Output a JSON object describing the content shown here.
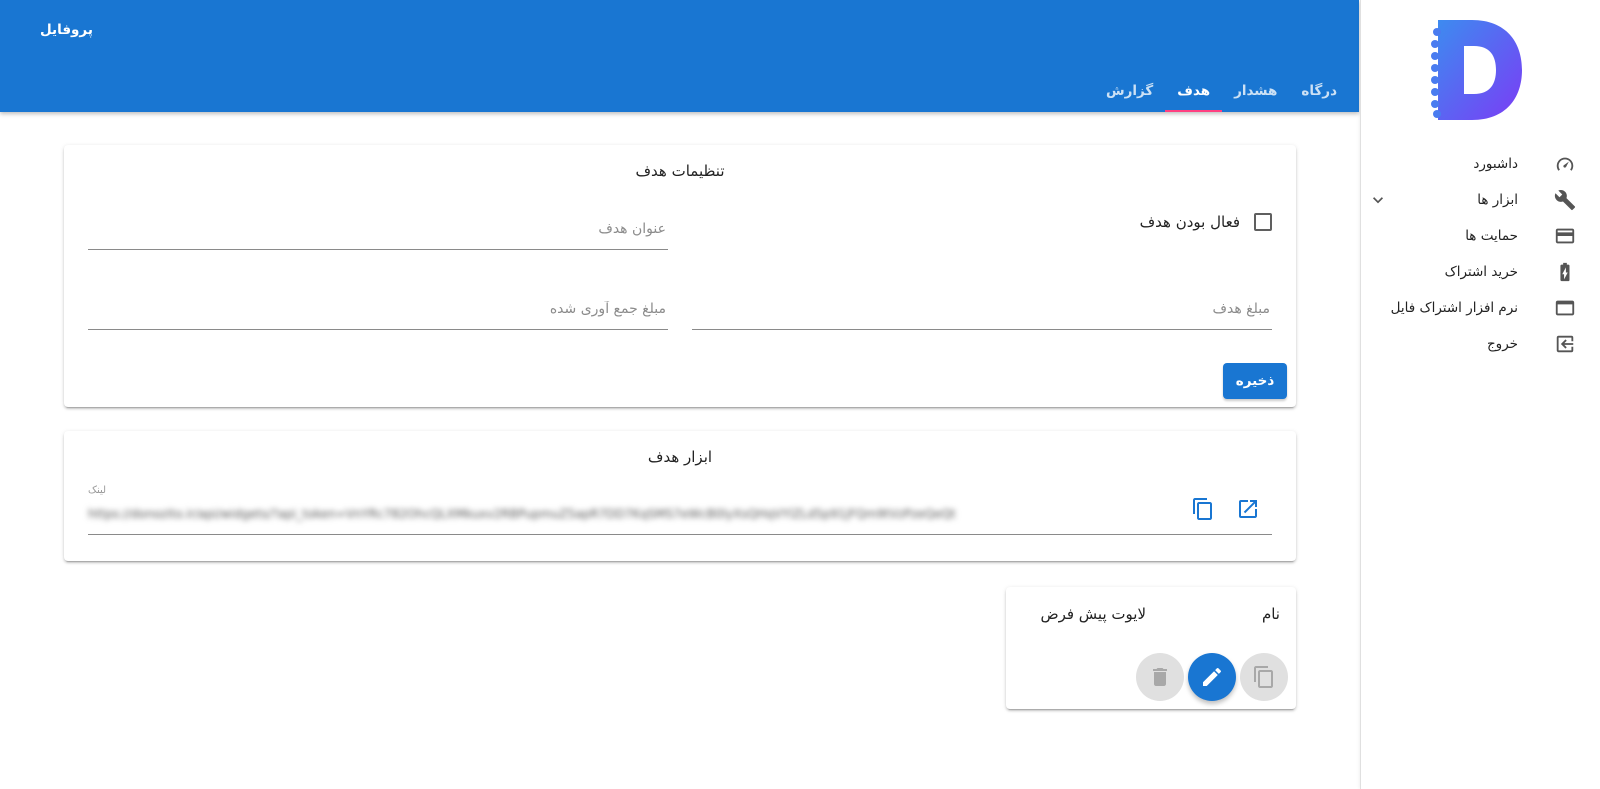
{
  "app": {
    "profile_label": "پروفایل"
  },
  "tabs": [
    {
      "label": "درگاه",
      "active": false
    },
    {
      "label": "هشدار",
      "active": false
    },
    {
      "label": "هدف",
      "active": true
    },
    {
      "label": "گزارش",
      "active": false
    }
  ],
  "sidebar": {
    "logo_icon": "logo-d-icon",
    "items": [
      {
        "label": "داشبورد",
        "icon": "speedometer-icon"
      },
      {
        "label": "ابزار ها",
        "icon": "wrench-icon",
        "expandable": true
      },
      {
        "label": "حمایت ها",
        "icon": "credit-card-icon"
      },
      {
        "label": "خرید اشتراک",
        "icon": "battery-charging-icon"
      },
      {
        "label": "نرم افزار اشتراک فایل",
        "icon": "window-icon"
      },
      {
        "label": "خروج",
        "icon": "logout-icon"
      }
    ]
  },
  "goal_settings": {
    "title": "تنظیمات هدف",
    "active_checkbox_label": "فعال بودن هدف",
    "active_checked": false,
    "title_field_placeholder": "عنوان هدف",
    "amount_field_placeholder": "مبلغ هدف",
    "collected_field_placeholder": "مبلغ جمع آوری شده",
    "save_label": "ذخیره"
  },
  "goal_tools": {
    "title": "ابزار هدف",
    "link_caption": "لینک",
    "link_value": "https://donozito.ir/api/widgets/?api_token=VnYRc782OhcQLXMkuxv2RBPupmuZ5apR7DD7KqSMS7eWcB0lyXsQHqVYlZLd5p91jFQm9tVzPzeQeQt"
  },
  "layout_card": {
    "name_label": "نام",
    "name_value": "لایوت پیش فرض"
  },
  "colors": {
    "primary": "#1976d2",
    "tab_indicator": "#ff4081"
  }
}
